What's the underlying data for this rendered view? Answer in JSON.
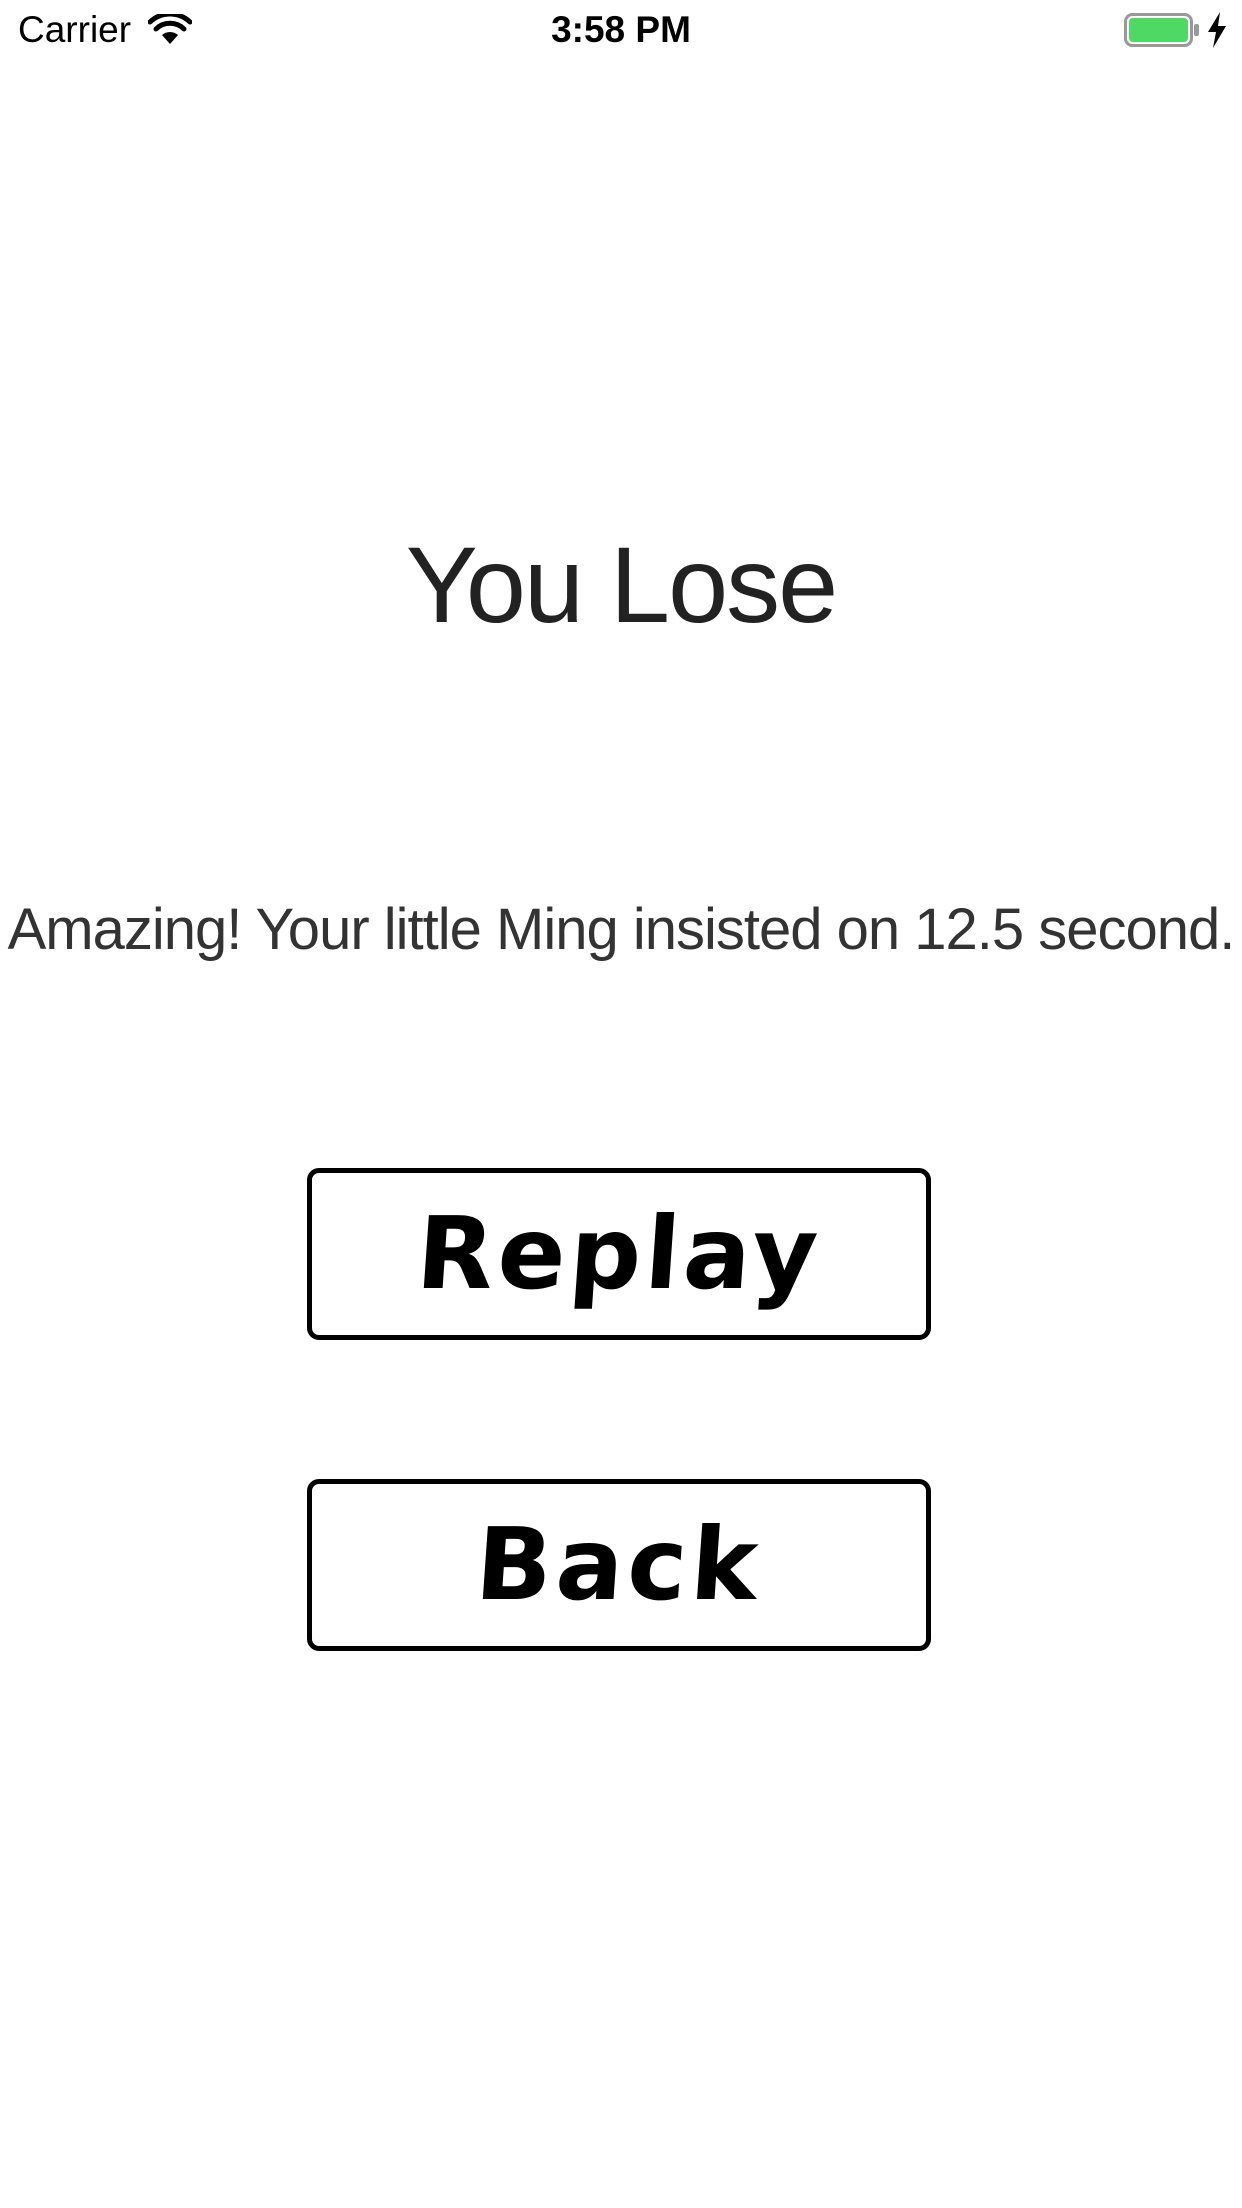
{
  "status_bar": {
    "carrier": "Carrier",
    "time": "3:58 PM",
    "battery_color": "#4cd964",
    "icons": [
      "wifi-icon",
      "battery-icon",
      "charging-icon"
    ]
  },
  "result": {
    "title": "You Lose",
    "message": "Amazing! Your little Ming insisted on 12.5 second."
  },
  "buttons": {
    "replay": "Replay",
    "back": "Back"
  }
}
